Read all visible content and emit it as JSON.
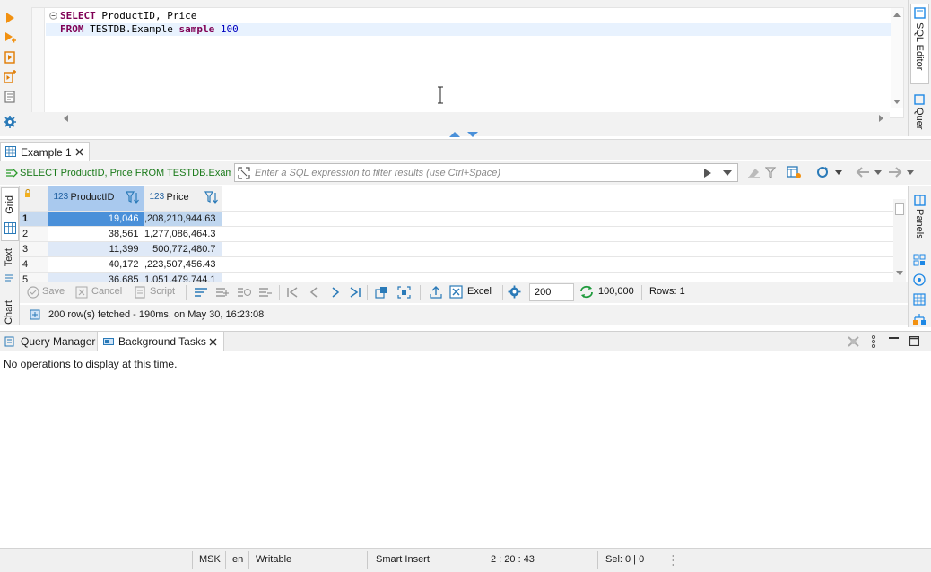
{
  "editor": {
    "line1": {
      "kw": "SELECT",
      "rest": " ProductID, Price"
    },
    "line2": {
      "kw1": "FROM",
      "mid": " TESTDB.Example ",
      "kw2": "sample",
      "num": "100"
    }
  },
  "right_side_tabs": {
    "sql_editor": "SQL Editor",
    "query": "Quer"
  },
  "results_tab": {
    "label": "Example 1"
  },
  "filter_bar": {
    "query_label": "SELECT ProductID, Price FROM TESTDB.Examp",
    "placeholder": "Enter a SQL expression to filter results (use Ctrl+Space)"
  },
  "side_views": {
    "grid": "Grid",
    "text": "Text",
    "chart": "Chart"
  },
  "right_panels": {
    "label": "Panels"
  },
  "grid": {
    "columns": [
      {
        "type_badge": "123",
        "name": "ProductID"
      },
      {
        "type_badge": "123",
        "name": "Price"
      }
    ],
    "rows": [
      {
        "num": "1",
        "product_id": "19,046",
        "price": ",208,210,944.63"
      },
      {
        "num": "2",
        "product_id": "38,561",
        "price": "1,277,086,464.3"
      },
      {
        "num": "3",
        "product_id": "11,399",
        "price": "500,772,480.7"
      },
      {
        "num": "4",
        "product_id": "40,172",
        "price": ",223,507,456.43"
      },
      {
        "num": "5",
        "product_id": "36,685",
        "price": "1,051,479,744.1"
      }
    ]
  },
  "grid_toolbar": {
    "save": "Save",
    "cancel": "Cancel",
    "script": "Script",
    "export": "Excel",
    "fetch_size": "200",
    "total": "100,000",
    "rows": "Rows: 1"
  },
  "status_fetched": "200 row(s) fetched - 190ms, on May 30, 16:23:08",
  "bottom_tabs": {
    "query_manager": "Query Manager",
    "background_tasks": "Background Tasks"
  },
  "bottom_message": "No operations to display at this time.",
  "statusbar": {
    "tz": "MSK",
    "lang": "en",
    "mode": "Writable",
    "insert": "Smart Insert",
    "position": "2 : 20 : 43",
    "selection": "Sel: 0 | 0"
  },
  "colors": {
    "accent": "#1e88e5",
    "selected_cell": "#4a90d9",
    "alt_row": "#dfe9f7",
    "keyword": "#7f0055",
    "number": "#0000c0"
  }
}
